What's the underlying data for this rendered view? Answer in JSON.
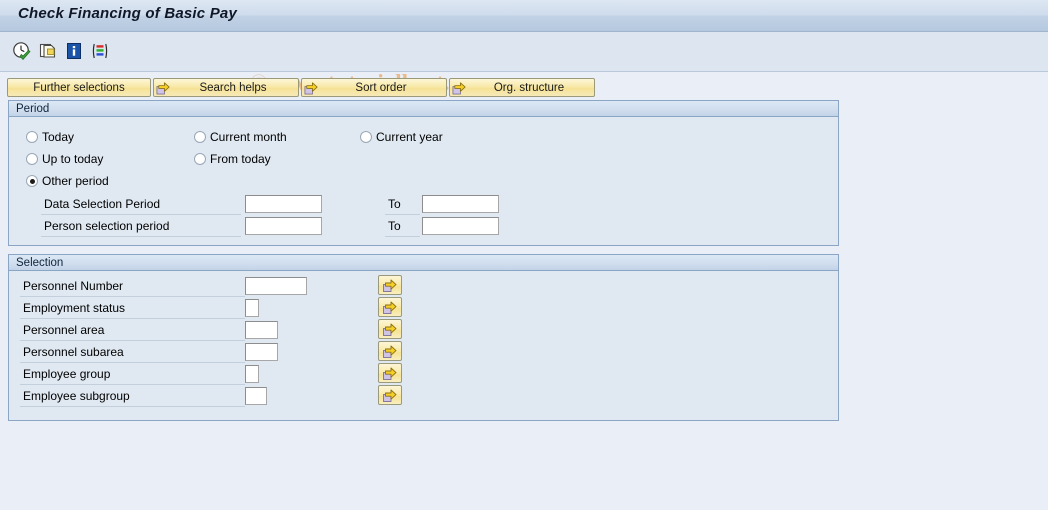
{
  "window": {
    "title": "Check Financing of Basic Pay"
  },
  "watermark": {
    "copyright": "©",
    "text": "www.tutorialkart.com"
  },
  "toolbar": {
    "icons": [
      {
        "name": "execute-clock-icon",
        "title": "Execute"
      },
      {
        "name": "copy-variant-icon",
        "title": "Get Variant"
      },
      {
        "name": "info-icon",
        "title": "Information"
      },
      {
        "name": "multiple-selection-icon",
        "title": "Multiple Selection"
      }
    ]
  },
  "buttons": [
    {
      "name": "further-selections-button",
      "label": "Further selections",
      "has_arrow": false
    },
    {
      "name": "search-helps-button",
      "label": "Search helps",
      "has_arrow": true
    },
    {
      "name": "sort-order-button",
      "label": "Sort order",
      "has_arrow": true
    },
    {
      "name": "org-structure-button",
      "label": "Org. structure",
      "has_arrow": true
    }
  ],
  "period": {
    "header": "Period",
    "radios": [
      {
        "name": "radio-today",
        "label": "Today",
        "checked": false
      },
      {
        "name": "radio-current-month",
        "label": "Current month",
        "checked": false
      },
      {
        "name": "radio-current-year",
        "label": "Current year",
        "checked": false
      },
      {
        "name": "radio-up-to-today",
        "label": "Up to today",
        "checked": false
      },
      {
        "name": "radio-from-today",
        "label": "From today",
        "checked": false
      },
      {
        "name": "radio-other-period",
        "label": "Other period",
        "checked": true
      }
    ],
    "to_label_1": "To",
    "to_label_2": "To",
    "fields": [
      {
        "name": "data-selection-period",
        "label": "Data Selection Period",
        "value": "",
        "to_value": ""
      },
      {
        "name": "person-selection-period",
        "label": "Person selection period",
        "value": "",
        "to_value": ""
      }
    ]
  },
  "selection": {
    "header": "Selection",
    "rows": [
      {
        "name": "personnel-number",
        "label": "Personnel Number",
        "value": ""
      },
      {
        "name": "employment-status",
        "label": "Employment status",
        "value": ""
      },
      {
        "name": "personnel-area",
        "label": "Personnel area",
        "value": ""
      },
      {
        "name": "personnel-subarea",
        "label": "Personnel subarea",
        "value": ""
      },
      {
        "name": "employee-group",
        "label": "Employee group",
        "value": ""
      },
      {
        "name": "employee-subgroup",
        "label": "Employee subgroup",
        "value": ""
      }
    ],
    "multi_select_title": "Multiple selection"
  },
  "colors": {
    "page_background": "#eaeff7",
    "group_background": "#e0e9f2",
    "group_border": "#8ba6c4",
    "button_yellow": "#f5e295",
    "watermark": "#e8b887",
    "title_bar": "#c2d2e6"
  }
}
